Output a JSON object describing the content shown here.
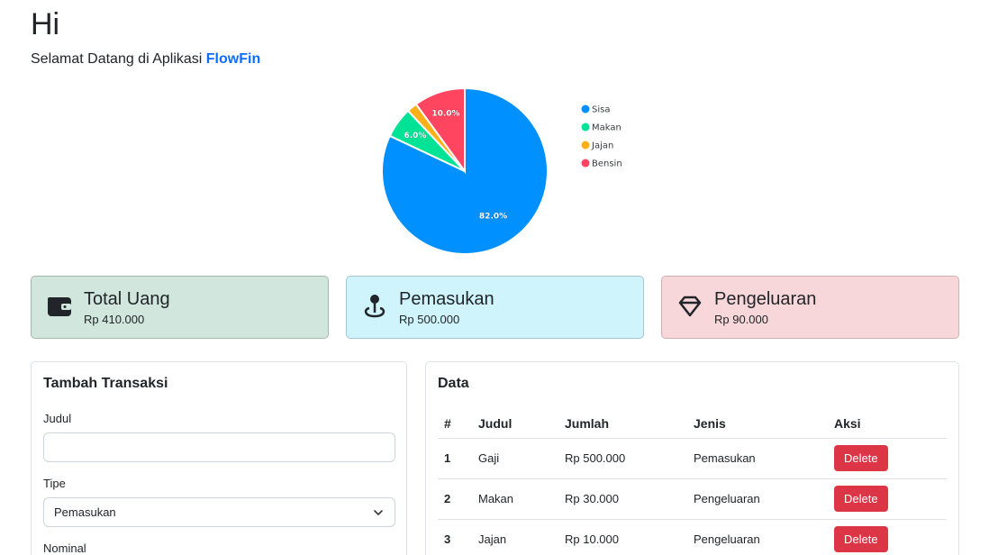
{
  "hero": {
    "title": "Hi",
    "subtitle_prefix": "Selamat Datang di Aplikasi ",
    "brand": "FlowFin"
  },
  "chart_data": {
    "type": "pie",
    "slices": [
      {
        "label": "Sisa",
        "value": 82.0,
        "display": "82.0%",
        "color": "#0090ff"
      },
      {
        "label": "Makan",
        "value": 6.0,
        "display": "6.0%",
        "color": "#00e396"
      },
      {
        "label": "Jajan",
        "value": 2.0,
        "display": "",
        "color": "#feb019"
      },
      {
        "label": "Bensin",
        "value": 10.0,
        "display": "10.0%",
        "color": "#ff4560"
      }
    ],
    "legend_position": "right"
  },
  "cards": [
    {
      "label": "Total Uang",
      "value": "Rp 410.000",
      "icon": "wallet-icon"
    },
    {
      "label": "Pemasukan",
      "value": "Rp 500.000",
      "icon": "pin-icon"
    },
    {
      "label": "Pengeluaran",
      "value": "Rp 90.000",
      "icon": "diamond-icon"
    }
  ],
  "form": {
    "title": "Tambah Transaksi",
    "judul_label": "Judul",
    "judul_value": "",
    "tipe_label": "Tipe",
    "tipe_value": "Pemasukan",
    "nominal_label": "Nominal"
  },
  "data_table": {
    "title": "Data",
    "headers": [
      "#",
      "Judul",
      "Jumlah",
      "Jenis",
      "Aksi"
    ],
    "rows": [
      {
        "no": "1",
        "judul": "Gaji",
        "jumlah": "Rp 500.000",
        "jenis": "Pemasukan",
        "aksi": "Delete"
      },
      {
        "no": "2",
        "judul": "Makan",
        "jumlah": "Rp 30.000",
        "jenis": "Pengeluaran",
        "aksi": "Delete"
      },
      {
        "no": "3",
        "judul": "Jajan",
        "jumlah": "Rp 10.000",
        "jenis": "Pengeluaran",
        "aksi": "Delete"
      }
    ]
  },
  "colors": {
    "brand": "#0d6efd",
    "delete": "#dc3545",
    "card_success": "#d1e7dd",
    "card_info": "#cff4fc",
    "card_danger": "#f8d7da"
  }
}
